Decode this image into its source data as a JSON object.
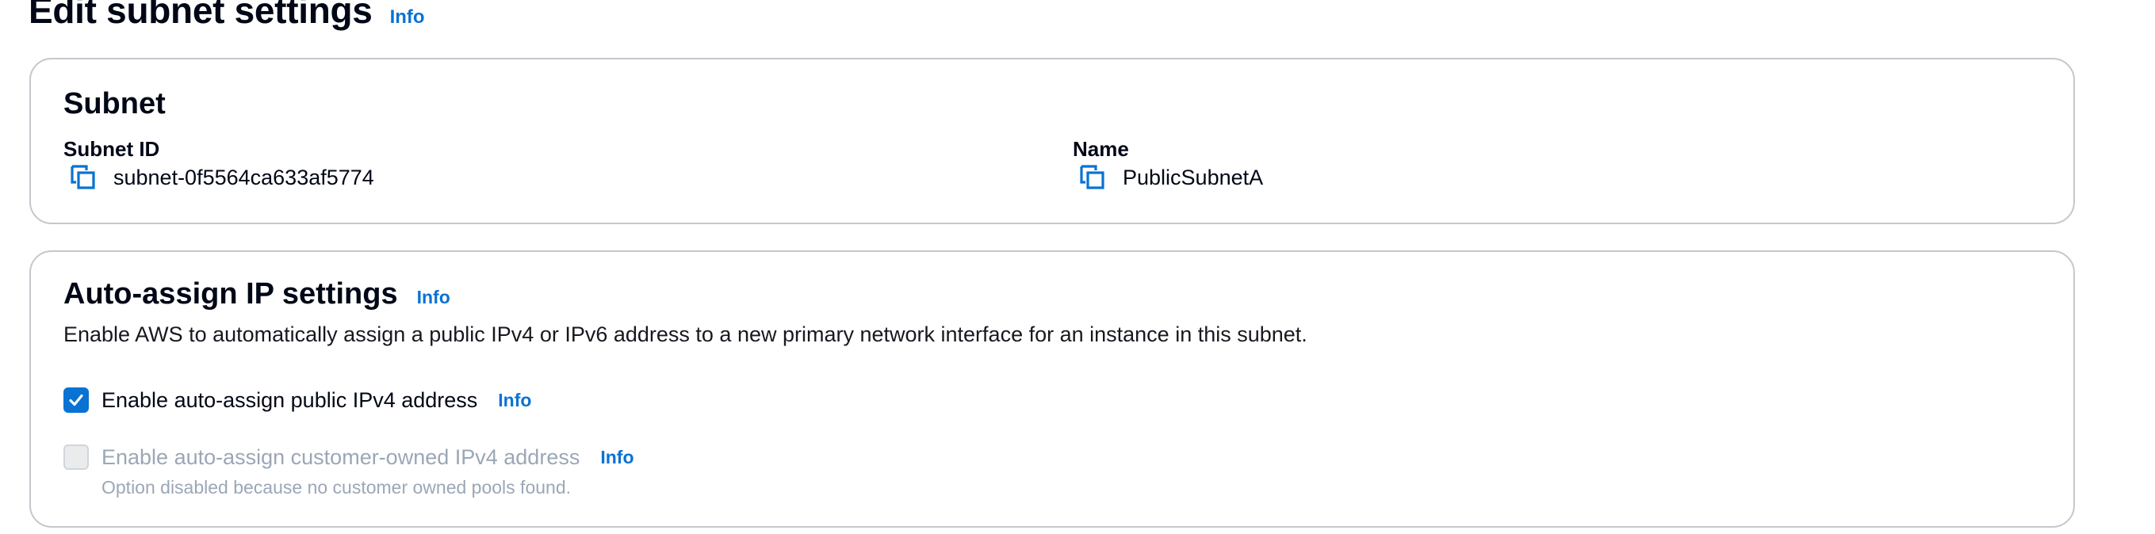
{
  "header": {
    "title": "Edit subnet settings",
    "info_label": "Info"
  },
  "subnet": {
    "title": "Subnet",
    "subnet_id_label": "Subnet ID",
    "subnet_id_value": "subnet-0f5564ca633af5774",
    "name_label": "Name",
    "name_value": "PublicSubnetA"
  },
  "auto_assign": {
    "title": "Auto-assign IP settings",
    "info_label": "Info",
    "description": "Enable AWS to automatically assign a public IPv4 or IPv6 address to a new primary network interface for an instance in this subnet.",
    "options": [
      {
        "label": "Enable auto-assign public IPv4 address",
        "info_label": "Info",
        "checked": true,
        "disabled": false
      },
      {
        "label": "Enable auto-assign customer-owned IPv4 address",
        "info_label": "Info",
        "checked": false,
        "disabled": true,
        "hint": "Option disabled because no customer owned pools found."
      }
    ]
  },
  "icons": {
    "copy": "copy-icon",
    "checkmark": "checkmark-icon"
  },
  "colors": {
    "link": "#0972d3",
    "checkbox_checked": "#0972d3",
    "disabled_text": "#9ba7b6",
    "border": "#c6c6cd",
    "text": "#000716"
  }
}
